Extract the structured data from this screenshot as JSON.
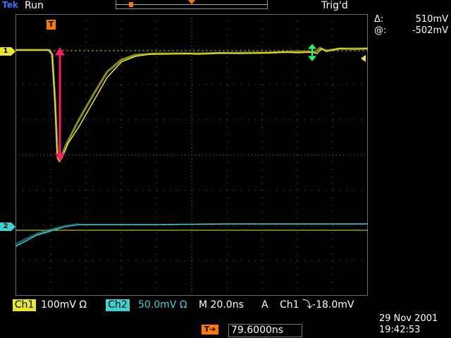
{
  "header": {
    "logo_text": "Tek",
    "acq_state": "Run",
    "trigger_status": "Trig'd"
  },
  "cursor_readout": {
    "delta_symbol": "Δ:",
    "delta_value": "510mV",
    "at_symbol": "@:",
    "at_value": "-502mV"
  },
  "markers": {
    "ch1": "1",
    "ch2": "2",
    "trigger_t": "T"
  },
  "status": {
    "ch1_label": "Ch1",
    "ch1_scale": "100mV Ω",
    "ch2_label": "Ch2",
    "ch2_scale": "50.0mV Ω",
    "timebase": "M 20.0ns",
    "trigger_mode": "A",
    "trigger_source": "Ch1",
    "trigger_level": "⤵-18.0mV"
  },
  "trigger_position": {
    "arrow_label": "T➔",
    "value": "79.6000ns"
  },
  "datetime": {
    "date": "29 Nov 2001",
    "time": "19:42:53"
  },
  "colors": {
    "ch1": "#e8e82a",
    "ch2": "#3bd4d4",
    "cursor": "#ff1a6a",
    "trigger": "#ff7a00",
    "green_cursor": "#1aff6a"
  }
}
